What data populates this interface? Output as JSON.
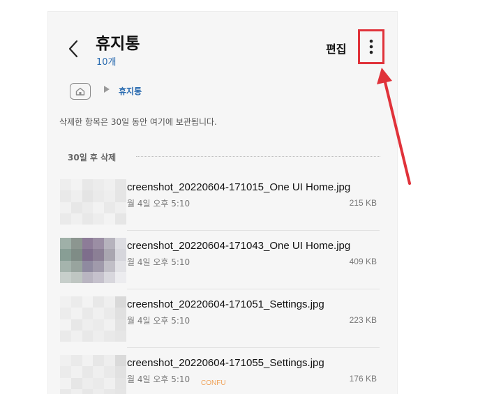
{
  "header": {
    "back_icon": "chevron-left-icon",
    "title": "휴지통",
    "count": "10개",
    "edit_label": "편집",
    "more_icon": "more-vertical-icon"
  },
  "breadcrumb": {
    "home_icon": "home-folder-icon",
    "separator_icon": "triangle-right-icon",
    "current": "휴지통"
  },
  "notice": "삭제한 항목은 30일 동안 여기에 보관됩니다.",
  "section": {
    "title": "30일 후 삭제"
  },
  "files": [
    {
      "name": "creenshot_20220604-171015_One UI Home.jpg",
      "date": "월 4일 오후 5:10",
      "size": "215 KB"
    },
    {
      "name": "creenshot_20220604-171043_One UI Home.jpg",
      "date": "월 4일 오후 5:10",
      "size": "409 KB"
    },
    {
      "name": "creenshot_20220604-171051_Settings.jpg",
      "date": "월 4일 오후 5:10",
      "size": "223 KB"
    },
    {
      "name": "creenshot_20220604-171055_Settings.jpg",
      "date": "월 4일 오후 5:10",
      "size": "176 KB"
    }
  ],
  "overlay_sticker": "CONFU",
  "colors": {
    "accent": "#2a6bb0",
    "highlight_box": "#e0323a",
    "background": "#f6f6f6"
  }
}
